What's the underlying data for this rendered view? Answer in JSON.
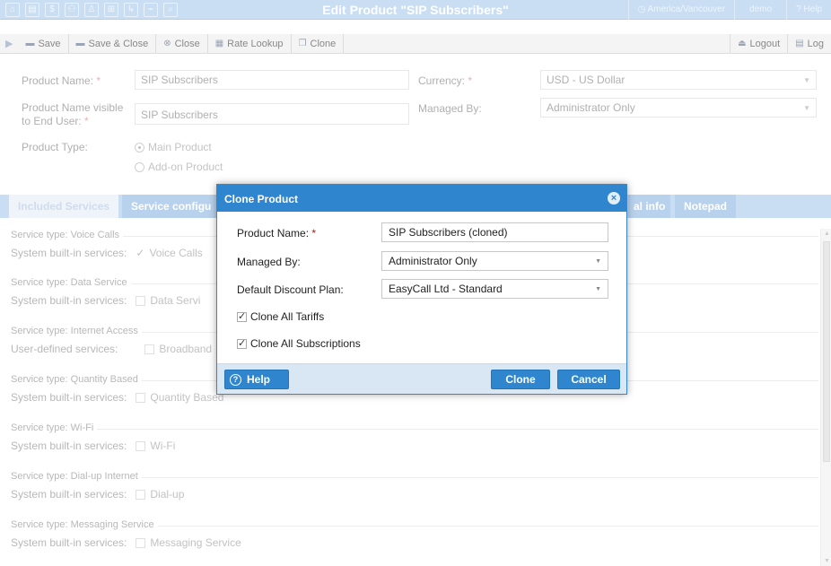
{
  "window": {
    "title": "Edit Product \"SIP Subscribers\"",
    "timezone": "America/Vancouver",
    "user": "demo",
    "help": "Help"
  },
  "toolbar": {
    "save": "Save",
    "save_close": "Save & Close",
    "close": "Close",
    "rate_lookup": "Rate Lookup",
    "clone": "Clone",
    "logout": "Logout",
    "log": "Log"
  },
  "form": {
    "product_name_label": "Product Name:",
    "product_name_value": "SIP Subscribers",
    "visible_name_label_1": "Product Name visible",
    "visible_name_label_2": "to End User:",
    "visible_name_value": "SIP Subscribers",
    "product_type_label": "Product Type:",
    "product_type_main": "Main Product",
    "product_type_addon": "Add-on Product",
    "currency_label": "Currency:",
    "currency_value": "USD - US Dollar",
    "managed_by_label": "Managed By:",
    "managed_by_value": "Administrator Only"
  },
  "tabs": {
    "included_services": "Included Services",
    "service_config": "Service configu",
    "additional_info": "al info",
    "notepad": "Notepad"
  },
  "services": [
    {
      "type": "Service type: Voice Calls",
      "kind": "System built-in services:",
      "name": "Voice Calls",
      "checked": true
    },
    {
      "type": "Service type: Data Service",
      "kind": "System built-in services:",
      "name": "Data Servi",
      "checked": false
    },
    {
      "type": "Service type: Internet Access",
      "kind": "User-defined services:",
      "name": "Broadband",
      "checked": false
    },
    {
      "type": "Service type: Quantity Based",
      "kind": "System built-in services:",
      "name": "Quantity Based",
      "checked": false
    },
    {
      "type": "Service type: Wi-Fi",
      "kind": "System built-in services:",
      "name": "Wi-Fi",
      "checked": false
    },
    {
      "type": "Service type: Dial-up Internet",
      "kind": "System built-in services:",
      "name": "Dial-up",
      "checked": false
    },
    {
      "type": "Service type: Messaging Service",
      "kind": "System built-in services:",
      "name": "Messaging Service",
      "checked": false
    }
  ],
  "modal": {
    "title": "Clone Product",
    "product_name_label": "Product Name:",
    "product_name_value": "SIP Subscribers (cloned)",
    "managed_by_label": "Managed By:",
    "managed_by_value": "Administrator Only",
    "discount_plan_label": "Default Discount Plan:",
    "discount_plan_value": "EasyCall Ltd - Standard",
    "clone_tariffs": "Clone All Tariffs",
    "clone_subscriptions": "Clone All Subscriptions",
    "help": "Help",
    "clone": "Clone",
    "cancel": "Cancel"
  },
  "colors": {
    "accent": "#2f86cf",
    "header_bg": "#c9def3",
    "required": "#dd0000"
  },
  "icons": {
    "home": "home-icon",
    "close_modal": "close-circle-icon",
    "help": "question-circle-icon"
  }
}
